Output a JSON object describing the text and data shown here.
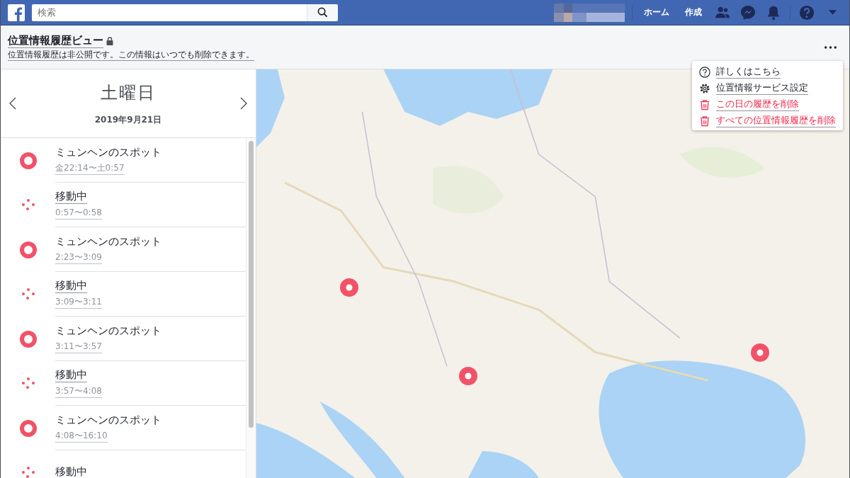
{
  "topbar": {
    "search": {
      "placeholder": "検索"
    },
    "nav": [
      "ホーム",
      "作成"
    ]
  },
  "header": {
    "title": "位置情報履歴ビュー",
    "subtitle": "位置情報履歴は非公開です。この情報はいつでも削除できます。"
  },
  "menu": {
    "items": [
      {
        "kind": "help",
        "label": "詳しくはこちら"
      },
      {
        "kind": "settings",
        "label": "位置情報サービス設定"
      },
      {
        "kind": "delete",
        "label": "この日の履歴を削除"
      },
      {
        "kind": "delete",
        "label": "すべての位置情報履歴を削除"
      }
    ]
  },
  "day": {
    "weekday": "土曜日",
    "date": "2019年9月21日"
  },
  "timeline": [
    {
      "kind": "stay",
      "title": "ミュンヘンのスポット",
      "time": "金22:14〜土0:57"
    },
    {
      "kind": "moving",
      "title": "移動中",
      "time": "0:57〜0:58"
    },
    {
      "kind": "stay",
      "title": "ミュンヘンのスポット",
      "time": "2:23〜3:09"
    },
    {
      "kind": "moving",
      "title": "移動中",
      "time": "3:09〜3:11"
    },
    {
      "kind": "stay",
      "title": "ミュンヘンのスポット",
      "time": "3:11〜3:57"
    },
    {
      "kind": "moving",
      "title": "移動中",
      "time": "3:57〜4:08"
    },
    {
      "kind": "stay",
      "title": "ミュンヘンのスポット",
      "time": "4:08〜16:10"
    },
    {
      "kind": "moving",
      "title": "移動中"
    }
  ]
}
